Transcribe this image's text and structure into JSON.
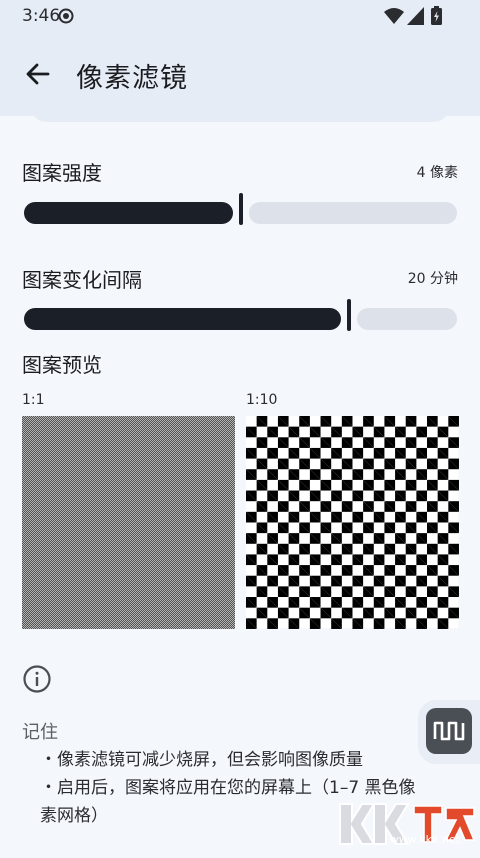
{
  "status_bar": {
    "time": "3:46",
    "icons": [
      "brightness-icon",
      "wifi-icon",
      "signal-icon",
      "battery-icon"
    ]
  },
  "app_bar": {
    "title": "像素滤镜",
    "back_icon": "arrow-left-icon"
  },
  "pattern_strength": {
    "label": "图案强度",
    "value_text": "4 像素",
    "fraction": 0.5
  },
  "pattern_interval": {
    "label": "图案变化间隔",
    "value_text": "20 分钟",
    "fraction": 0.75
  },
  "preview": {
    "label": "图案预览",
    "left_caption": "1:1",
    "right_caption": "1:10"
  },
  "notes": {
    "icon": "info-icon",
    "title": "记住",
    "bullets": [
      "・像素滤镜可减少烧屏，但会影响图像质量",
      "・启用后，图案将应用在您的屏幕上（1–7 黑色像",
      "素网格）"
    ]
  },
  "floating_button": {
    "icon": "pattern-wave-icon"
  },
  "watermark": {
    "url": "www.kkx.net"
  },
  "colors": {
    "accent": "#1b1f28",
    "track_inactive": "#dde2ea",
    "surface": "#f4f7fc",
    "app_bar": "#e6ecf5"
  }
}
